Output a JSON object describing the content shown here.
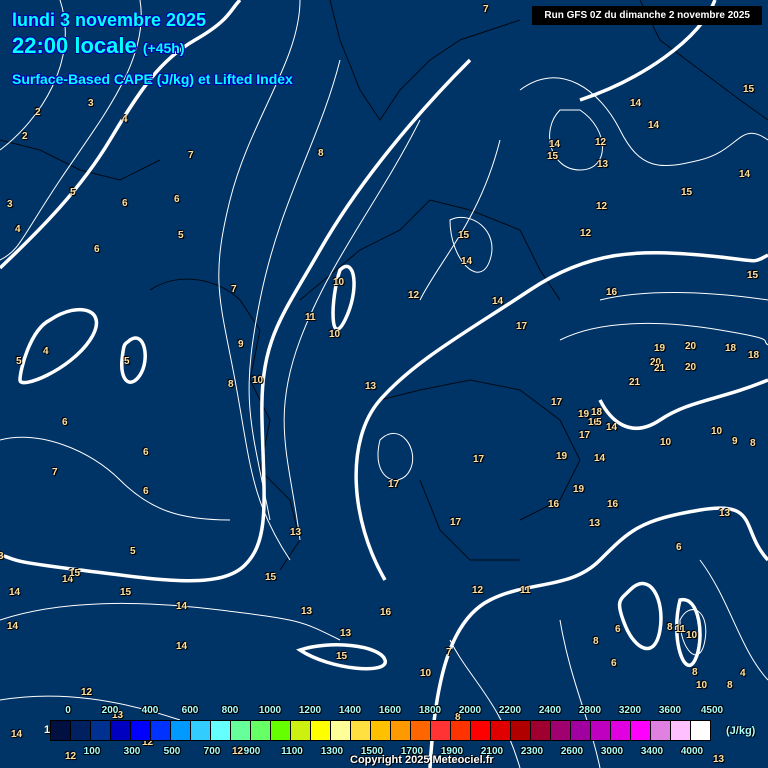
{
  "header": {
    "date": "lundi 3 novembre 2025",
    "time": "22:00 locale",
    "lead": "(+45h)",
    "parameter": "Surface-Based CAPE (J/kg) et Lifted Index",
    "run": "Run GFS 0Z du dimanche 2 novembre 2025"
  },
  "colors": {
    "background": "#003366",
    "scale": [
      "#001040",
      "#002060",
      "#003090",
      "#0000c0",
      "#0000ff",
      "#0033ff",
      "#0099ff",
      "#33ccff",
      "#66ffff",
      "#66ff99",
      "#66ff66",
      "#66ff00",
      "#ccf010",
      "#ffff00",
      "#ffff99",
      "#ffe040",
      "#ffc000",
      "#ff9900",
      "#ff6600",
      "#ff3333",
      "#ff3300",
      "#ff0000",
      "#e00000",
      "#b00000",
      "#a00030",
      "#a00070",
      "#a000a0",
      "#c000c0",
      "#e000e0",
      "#ff00ff",
      "#e080e0",
      "#ffc0ff",
      "#ffffff"
    ]
  },
  "colorbar": {
    "low_label": "1",
    "top_ticks": [
      "0",
      "200",
      "400",
      "600",
      "800",
      "1000",
      "1200",
      "1400",
      "1600",
      "1800",
      "2000",
      "2200",
      "2400",
      "2800",
      "3200",
      "3600",
      "4500"
    ],
    "bottom_ticks": [
      "100",
      "300",
      "500",
      "700",
      "900",
      "1100",
      "1300",
      "1500",
      "1700",
      "1900",
      "2100",
      "2300",
      "2600",
      "3000",
      "3400",
      "4000"
    ],
    "unit": "(J/kg)"
  },
  "lifted_index_labels": [
    "7",
    "2",
    "3",
    "2",
    "4",
    "7",
    "8",
    "5",
    "6",
    "6",
    "3",
    "4",
    "5",
    "6",
    "7",
    "11",
    "10",
    "10",
    "9",
    "8",
    "10",
    "12",
    "13",
    "5",
    "4",
    "5",
    "6",
    "7",
    "6",
    "6",
    "5",
    "3",
    "14",
    "14",
    "15",
    "15",
    "14",
    "14",
    "14",
    "12",
    "15",
    "13",
    "13",
    "15",
    "16",
    "13",
    "17",
    "17",
    "17",
    "11",
    "12",
    "10",
    "7",
    "14",
    "14",
    "15",
    "14",
    "15",
    "12",
    "13",
    "14",
    "15",
    "12",
    "12",
    "15",
    "14",
    "15",
    "16",
    "14",
    "17",
    "19",
    "20",
    "18",
    "18",
    "20",
    "21",
    "20",
    "21",
    "17",
    "19",
    "18",
    "16",
    "5",
    "14",
    "17",
    "19",
    "14",
    "10",
    "10",
    "9",
    "8",
    "16",
    "19",
    "16",
    "13",
    "13",
    "6",
    "6",
    "8",
    "11",
    "10",
    "8",
    "6",
    "8",
    "10",
    "8",
    "4",
    "13",
    "14",
    "12",
    "13",
    "12",
    "12",
    "8"
  ],
  "copyright": "Copyright 2025 Meteociel.fr"
}
